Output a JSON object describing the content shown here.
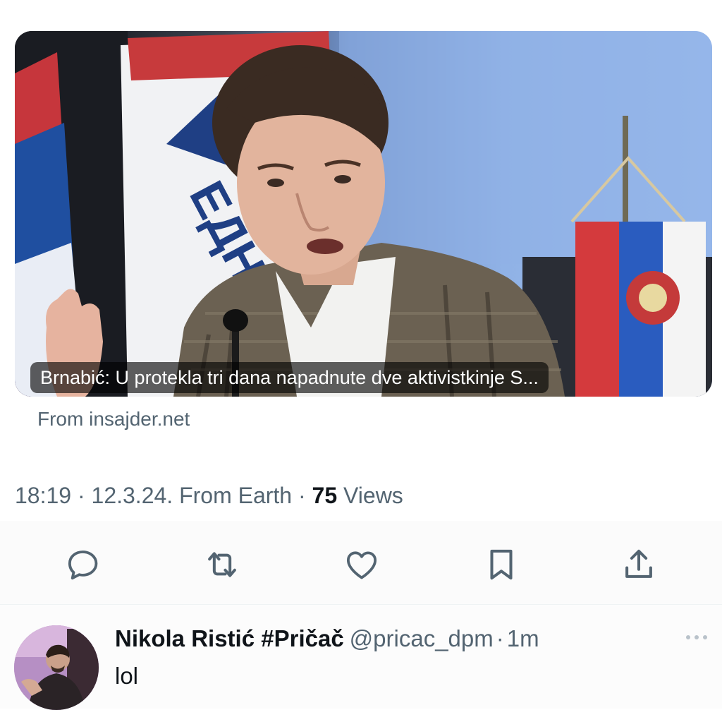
{
  "link_card": {
    "headline": "Brnabić: U protekla tri dana napadnute dve aktivistkinje S...",
    "source": "From insajder.net",
    "flag_text": "ЕДНА"
  },
  "meta": {
    "time": "18:19",
    "date": "12.3.24.",
    "location": "From Earth",
    "views_count": "75",
    "views_label": "Views",
    "sep": "·"
  },
  "actions": [
    {
      "name": "reply-icon"
    },
    {
      "name": "retweet-icon"
    },
    {
      "name": "like-icon"
    },
    {
      "name": "bookmark-icon"
    },
    {
      "name": "share-icon"
    }
  ],
  "reply": {
    "name": "Nikola Ristić #Pričač",
    "handle": "@pricac_dpm",
    "sep": "·",
    "time": "1m",
    "text": "lol",
    "more_icon": "more-dots-icon"
  },
  "colors": {
    "text_primary": "#0f1419",
    "text_secondary": "#536471",
    "icon_gray": "#536471"
  }
}
